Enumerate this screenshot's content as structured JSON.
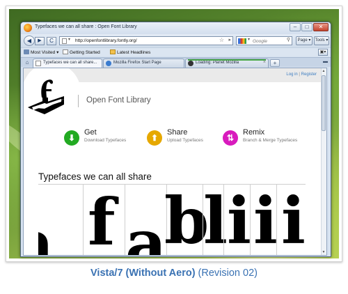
{
  "window": {
    "title": "Typefaces we can all share : Open Font Library",
    "controls": {
      "minimize": "–",
      "maximize": "□",
      "close": "✕"
    }
  },
  "navbar": {
    "back": "◀",
    "forward": "▶",
    "reload": "C",
    "url": "http://openfontlibrary.fontly.org/",
    "search_placeholder": "Google",
    "page_button": "Page ▾",
    "tools_button": "Tools ▾"
  },
  "bookmarks": [
    {
      "label": "Most Visited ▾",
      "icon": "bookmark-star-icon"
    },
    {
      "label": "Getting Started",
      "icon": "page-icon"
    },
    {
      "label": "Latest Headlines",
      "icon": "rss-folder-icon"
    }
  ],
  "tabs": [
    {
      "label": "Typefaces we can all share...",
      "active": true,
      "icon": "page-icon"
    },
    {
      "label": "Mozilla Firefox Start Page",
      "active": false,
      "icon": "mozilla-icon"
    },
    {
      "label": "Loading: Planet Mozilla",
      "active": false,
      "icon": "loading-icon"
    }
  ],
  "page": {
    "auth": {
      "login": "Log in",
      "separator": "|",
      "register": "Register"
    },
    "site_name": "Open Font Library",
    "features": [
      {
        "title": "Get",
        "subtitle": "Download Typefaces",
        "color": "#22aa22",
        "icon": "download-icon"
      },
      {
        "title": "Share",
        "subtitle": "Upload Typefaces",
        "color": "#e6a800",
        "icon": "upload-icon"
      },
      {
        "title": "Remix",
        "subtitle": "Branch & Merge Typefaces",
        "color": "#d81bbd",
        "icon": "remix-icon"
      }
    ],
    "section_title": "Typefaces we can all share",
    "glyphs": [
      "a",
      "f",
      "a",
      "b",
      "l",
      "i",
      "i",
      "i"
    ]
  },
  "caption": {
    "bold": "Vista/7 (Without Aero)",
    "rest": " (Revision 02)"
  },
  "colors": {
    "caption_blue": "#3a72b3",
    "link_blue": "#3a7bc0",
    "window_chrome": "#d6e2f0"
  }
}
